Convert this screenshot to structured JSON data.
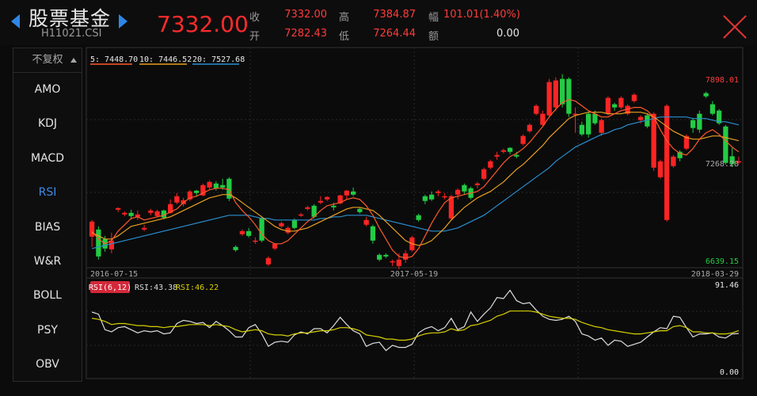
{
  "header": {
    "title": "股票基金",
    "code": "H11021.CSI",
    "price": "7332.00",
    "quotes": [
      {
        "label": "收",
        "value": "7332.00",
        "color": "#ff3b3b"
      },
      {
        "label": "开",
        "value": "7282.43",
        "color": "#ff3b3b"
      },
      {
        "label": "高",
        "value": "7384.87",
        "color": "#ff3b3b"
      },
      {
        "label": "低",
        "value": "7264.44",
        "color": "#ff3b3b"
      },
      {
        "label": "幅",
        "value": "101.01(1.40%)",
        "color": "#ff3b3b"
      },
      {
        "label": "额",
        "value": "0.00",
        "color": "#e6e6e6"
      }
    ]
  },
  "sidebar": {
    "fuquan": "不复权",
    "items": [
      "AMO",
      "KDJ",
      "MACD",
      "RSI",
      "BIAS",
      "W&R",
      "BOLL",
      "PSY",
      "OBV"
    ],
    "active": "RSI"
  },
  "main_legend": {
    "ma5": {
      "label": "5: 7448.70",
      "color": "#e8e8e8",
      "line": "#ff5a2a"
    },
    "ma10": {
      "label": "10: 7446.52",
      "color": "#e8e8e8",
      "line": "#e8a020"
    },
    "ma20": {
      "label": "20: 7527.68",
      "color": "#e8e8e8",
      "line": "#2a8fd0"
    }
  },
  "main_axis": {
    "high_label": "7898.01",
    "mid_label": "7268.28",
    "low_label": "6639.15",
    "x_labels": [
      "2016-07-15",
      "2017-05-19",
      "2018-03-29"
    ]
  },
  "rsi_legend": {
    "badge": "RSI(6,12)",
    "rsi1": "RSI:43.38",
    "rsi2": "RSI:46.22",
    "top_label": "91.46",
    "bottom_label": "0.00"
  },
  "colors": {
    "up": "#ff2424",
    "down": "#22cc44",
    "rsi1": "#dcdcdc",
    "rsi2": "#d8d000"
  },
  "chart_data": {
    "type": "candlestick",
    "ylim": [
      6639.15,
      7898.01
    ],
    "candles": [
      [
        6825,
        6920,
        6930,
        6760
      ],
      [
        6870,
        6700,
        6890,
        6680
      ],
      [
        6810,
        6750,
        6830,
        6730
      ],
      [
        6745,
        6800,
        6850,
        6720
      ],
      [
        6995,
        7005,
        7010,
        6980
      ],
      [
        6965,
        6975,
        6985,
        6955
      ],
      [
        6975,
        6955,
        6995,
        6935
      ],
      [
        6950,
        6965,
        6990,
        6930
      ],
      [
        6870,
        6880,
        6900,
        6860
      ],
      [
        6975,
        6990,
        7000,
        6960
      ],
      [
        6955,
        6985,
        6995,
        6950
      ],
      [
        6990,
        6945,
        6995,
        6935
      ],
      [
        6975,
        7030,
        7060,
        6970
      ],
      [
        7040,
        7080,
        7100,
        7030
      ],
      [
        7030,
        7055,
        7070,
        7015
      ],
      [
        7060,
        7110,
        7120,
        7050
      ],
      [
        7115,
        7100,
        7120,
        7080
      ],
      [
        7085,
        7150,
        7160,
        7080
      ],
      [
        7135,
        7170,
        7180,
        7125
      ],
      [
        7160,
        7130,
        7175,
        7115
      ],
      [
        7150,
        7135,
        7190,
        7120
      ],
      [
        7190,
        7065,
        7200,
        7050
      ],
      [
        6760,
        6740,
        6770,
        6730
      ],
      [
        6840,
        6860,
        6870,
        6830
      ],
      [
        6860,
        6830,
        6880,
        6820
      ],
      [
        6800,
        6800,
        6820,
        6780
      ],
      [
        6940,
        6800,
        6950,
        6790
      ],
      [
        6650,
        6690,
        6700,
        6640
      ],
      [
        6750,
        6780,
        6780,
        6740
      ],
      [
        6890,
        6910,
        6920,
        6880
      ],
      [
        6850,
        6880,
        6890,
        6840
      ],
      [
        6930,
        6880,
        6940,
        6870
      ],
      [
        6965,
        6965,
        6975,
        6950
      ],
      [
        7000,
        7010,
        7020,
        6990
      ],
      [
        7020,
        6950,
        7030,
        6940
      ],
      [
        7040,
        7050,
        7080,
        7030
      ],
      [
        7060,
        7075,
        7080,
        7050
      ],
      [
        7020,
        7010,
        7040,
        6990
      ],
      [
        7035,
        7085,
        7090,
        7030
      ],
      [
        7085,
        7115,
        7120,
        7060
      ],
      [
        7110,
        7090,
        7135,
        7080
      ],
      [
        7000,
        6980,
        7010,
        6970
      ],
      [
        6900,
        6930,
        6950,
        6890
      ],
      [
        6890,
        6800,
        6900,
        6780
      ],
      [
        6710,
        6680,
        6720,
        6670
      ],
      [
        6710,
        6700,
        6720,
        6690
      ],
      [
        6670,
        6670,
        6680,
        6640
      ],
      [
        6640,
        6680,
        6720,
        6620
      ],
      [
        6680,
        6720,
        6740,
        6660
      ],
      [
        6740,
        6820,
        6830,
        6730
      ],
      [
        6960,
        6930,
        6970,
        6920
      ],
      [
        7080,
        7050,
        7090,
        7030
      ],
      [
        7090,
        7060,
        7110,
        7050
      ],
      [
        7100,
        7110,
        7120,
        7080
      ],
      [
        7080,
        7080,
        7100,
        7060
      ],
      [
        6940,
        7080,
        7090,
        6930
      ],
      [
        7090,
        7120,
        7130,
        7060
      ],
      [
        7150,
        7110,
        7160,
        7090
      ],
      [
        7130,
        7070,
        7140,
        7060
      ],
      [
        7150,
        7160,
        7170,
        7130
      ],
      [
        7190,
        7250,
        7260,
        7180
      ],
      [
        7260,
        7300,
        7310,
        7250
      ],
      [
        7330,
        7340,
        7360,
        7310
      ],
      [
        7360,
        7370,
        7380,
        7350
      ],
      [
        7385,
        7360,
        7390,
        7345
      ],
      [
        7340,
        7330,
        7360,
        7320
      ],
      [
        7410,
        7460,
        7470,
        7400
      ],
      [
        7490,
        7530,
        7540,
        7480
      ],
      [
        7600,
        7650,
        7660,
        7590
      ],
      [
        7530,
        7600,
        7620,
        7520
      ],
      [
        7590,
        7800,
        7820,
        7580
      ],
      [
        7640,
        7810,
        7830,
        7620
      ],
      [
        7820,
        7660,
        7850,
        7640
      ],
      [
        7820,
        7600,
        7830,
        7580
      ],
      [
        7600,
        7600,
        7640,
        7480
      ],
      [
        7530,
        7470,
        7550,
        7460
      ],
      [
        7600,
        7470,
        7610,
        7450
      ],
      [
        7600,
        7540,
        7620,
        7530
      ],
      [
        7480,
        7560,
        7570,
        7460
      ],
      [
        7600,
        7700,
        7710,
        7590
      ],
      [
        7660,
        7640,
        7670,
        7620
      ],
      [
        7640,
        7700,
        7710,
        7630
      ],
      [
        7600,
        7650,
        7660,
        7590
      ],
      [
        7680,
        7720,
        7730,
        7670
      ],
      [
        7560,
        7580,
        7590,
        7540
      ],
      [
        7590,
        7520,
        7600,
        7510
      ],
      [
        7260,
        7600,
        7610,
        7240
      ],
      [
        7200,
        7300,
        7310,
        7190
      ],
      [
        6930,
        7650,
        7660,
        6920
      ],
      [
        7270,
        7330,
        7340,
        7260
      ],
      [
        7360,
        7320,
        7370,
        7300
      ],
      [
        7380,
        7460,
        7470,
        7370
      ],
      [
        7560,
        7510,
        7570,
        7480
      ],
      [
        7600,
        7500,
        7620,
        7480
      ],
      [
        7730,
        7710,
        7740,
        7700
      ],
      [
        7660,
        7600,
        7680,
        7590
      ],
      [
        7620,
        7540,
        7630,
        7530
      ],
      [
        7520,
        7290,
        7530,
        7280
      ],
      [
        7332,
        7282.43,
        7384.87,
        7264.44
      ],
      [
        7300,
        7300,
        7330,
        7280
      ]
    ],
    "ma5": [
      6860,
      6810,
      6780,
      6800,
      6860,
      6900,
      6940,
      6950,
      6930,
      6940,
      6950,
      6960,
      6980,
      7000,
      7040,
      7070,
      7080,
      7100,
      7120,
      7130,
      7130,
      7120,
      7040,
      6990,
      6950,
      6900,
      6840,
      6800,
      6780,
      6780,
      6800,
      6840,
      6880,
      6920,
      6950,
      6990,
      7020,
      7030,
      7040,
      7060,
      7070,
      7060,
      7020,
      6960,
      6880,
      6810,
      6740,
      6700,
      6690,
      6700,
      6750,
      6830,
      6910,
      6980,
      7040,
      7070,
      7080,
      7090,
      7100,
      7110,
      7140,
      7190,
      7240,
      7290,
      7330,
      7350,
      7380,
      7420,
      7470,
      7520,
      7580,
      7630,
      7670,
      7690,
      7680,
      7650,
      7620,
      7600,
      7580,
      7580,
      7600,
      7620,
      7630,
      7640,
      7640,
      7620,
      7580,
      7500,
      7430,
      7380,
      7350,
      7340,
      7380,
      7440,
      7480,
      7500,
      7470,
      7430,
      7390,
      7360
    ],
    "ma10": [
      6850,
      6830,
      6810,
      6810,
      6830,
      6860,
      6890,
      6900,
      6910,
      6920,
      6930,
      6940,
      6950,
      6970,
      6990,
      7010,
      7030,
      7050,
      7070,
      7080,
      7090,
      7090,
      7070,
      7040,
      7010,
      6980,
      6950,
      6920,
      6890,
      6870,
      6860,
      6860,
      6870,
      6880,
      6900,
      6920,
      6940,
      6960,
      6980,
      7000,
      7010,
      7010,
      7000,
      6990,
      6960,
      6920,
      6880,
      6840,
      6800,
      6780,
      6770,
      6780,
      6800,
      6840,
      6880,
      6930,
      6970,
      7010,
      7040,
      7070,
      7090,
      7110,
      7140,
      7170,
      7210,
      7250,
      7280,
      7320,
      7360,
      7400,
      7450,
      7490,
      7530,
      7570,
      7590,
      7600,
      7610,
      7610,
      7610,
      7600,
      7600,
      7600,
      7610,
      7610,
      7610,
      7600,
      7580,
      7550,
      7520,
      7490,
      7470,
      7450,
      7440,
      7440,
      7450,
      7460,
      7460,
      7450,
      7440,
      7430
    ],
    "ma20": [
      6750,
      6760,
      6770,
      6780,
      6790,
      6800,
      6810,
      6820,
      6830,
      6840,
      6850,
      6860,
      6870,
      6880,
      6890,
      6900,
      6910,
      6920,
      6930,
      6940,
      6950,
      6960,
      6960,
      6960,
      6960,
      6950,
      6940,
      6940,
      6930,
      6930,
      6930,
      6930,
      6930,
      6930,
      6930,
      6940,
      6940,
      6950,
      6950,
      6960,
      6960,
      6960,
      6960,
      6950,
      6940,
      6930,
      6920,
      6910,
      6900,
      6890,
      6880,
      6870,
      6860,
      6860,
      6860,
      6870,
      6880,
      6900,
      6920,
      6940,
      6960,
      6990,
      7020,
      7050,
      7080,
      7110,
      7140,
      7170,
      7200,
      7230,
      7260,
      7300,
      7330,
      7360,
      7390,
      7410,
      7430,
      7450,
      7470,
      7480,
      7500,
      7510,
      7530,
      7540,
      7550,
      7560,
      7570,
      7580,
      7580,
      7580,
      7580,
      7580,
      7570,
      7570,
      7570,
      7560,
      7550,
      7550,
      7540,
      7530
    ],
    "rsi6": [
      64,
      62,
      47,
      45,
      49,
      50,
      47,
      44,
      46,
      45,
      46,
      43,
      44,
      53,
      56,
      55,
      53,
      54,
      49,
      55,
      51,
      46,
      40,
      40,
      49,
      52,
      43,
      31,
      35,
      36,
      35,
      42,
      45,
      43,
      48,
      48,
      44,
      51,
      59,
      52,
      46,
      43,
      31,
      34,
      35,
      27,
      32,
      30,
      30,
      33,
      44,
      48,
      50,
      46,
      49,
      58,
      47,
      50,
      64,
      55,
      62,
      68,
      78,
      77,
      85,
      75,
      72,
      73,
      66,
      60,
      57,
      56,
      57,
      60,
      55,
      43,
      41,
      37,
      39,
      32,
      37,
      36,
      31,
      33,
      35,
      40,
      45,
      49,
      48,
      60,
      59,
      49,
      40,
      43,
      43,
      44,
      40,
      39,
      43,
      43.38
    ],
    "rsi12": [
      58,
      57,
      55,
      52,
      53,
      53,
      52,
      51,
      51,
      50,
      50,
      49,
      50,
      50,
      51,
      52,
      52,
      52,
      51,
      52,
      51,
      50,
      47,
      45,
      46,
      47,
      46,
      43,
      42,
      42,
      41,
      43,
      44,
      44,
      45,
      46,
      46,
      47,
      49,
      49,
      48,
      46,
      42,
      41,
      40,
      38,
      38,
      37,
      37,
      38,
      41,
      43,
      44,
      44,
      45,
      48,
      46,
      47,
      51,
      52,
      54,
      56,
      60,
      62,
      65,
      65,
      65,
      65,
      64,
      62,
      60,
      59,
      58,
      58,
      57,
      54,
      52,
      50,
      49,
      47,
      46,
      45,
      44,
      43,
      43,
      44,
      45,
      46,
      46,
      50,
      51,
      49,
      45,
      45,
      44,
      44,
      43,
      43,
      44,
      46.22
    ]
  }
}
